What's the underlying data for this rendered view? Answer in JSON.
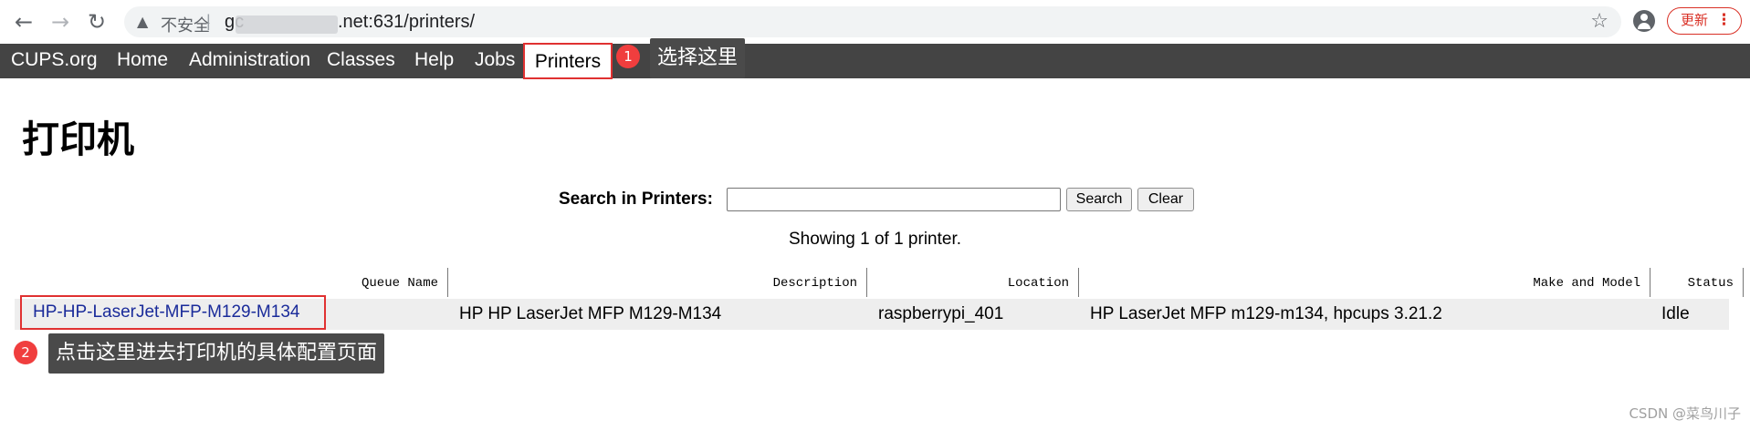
{
  "browser": {
    "back_icon": "←",
    "forward_icon": "→",
    "reload_icon": "↻",
    "warning_icon": "▲",
    "insecure_label": "不安全",
    "separator": "|",
    "url_host_prefix": "gc",
    "url_rest": ".net:631/printers/",
    "star_icon": "☆",
    "update_label": "更新",
    "menu_icon": "⋮"
  },
  "nav": {
    "items": [
      {
        "label": "CUPS.org"
      },
      {
        "label": "Home"
      },
      {
        "label": "Administration"
      },
      {
        "label": "Classes"
      },
      {
        "label": "Help"
      },
      {
        "label": "Jobs"
      },
      {
        "label": "Printers"
      }
    ]
  },
  "annotations": {
    "step1_number": "1",
    "step1_text": "选择这里",
    "step2_number": "2",
    "step2_text": "点击这里进去打印机的具体配置页面"
  },
  "page": {
    "title": "打印机",
    "search_label": "Search in Printers:",
    "search_value": "",
    "search_button": "Search",
    "clear_button": "Clear",
    "showing": "Showing 1 of 1 printer."
  },
  "table": {
    "headers": [
      "Queue Name",
      "Description",
      "Location",
      "Make and Model",
      "Status"
    ],
    "rows": [
      {
        "queue": "HP-HP-LaserJet-MFP-M129-M134",
        "description": "HP HP LaserJet MFP M129-M134",
        "location": "raspberrypi_401",
        "make_model": "HP LaserJet MFP m129-m134, hpcups 3.21.2",
        "status": "Idle"
      }
    ]
  },
  "watermark": "CSDN @菜鸟川子",
  "colors": {
    "nav_bg": "#444444",
    "highlight_red": "#e03131",
    "badge_red": "#f03e3e",
    "callout_bg": "#4a4a4a",
    "link_blue": "#1a2b9a",
    "row_bg": "#eeeeee"
  }
}
